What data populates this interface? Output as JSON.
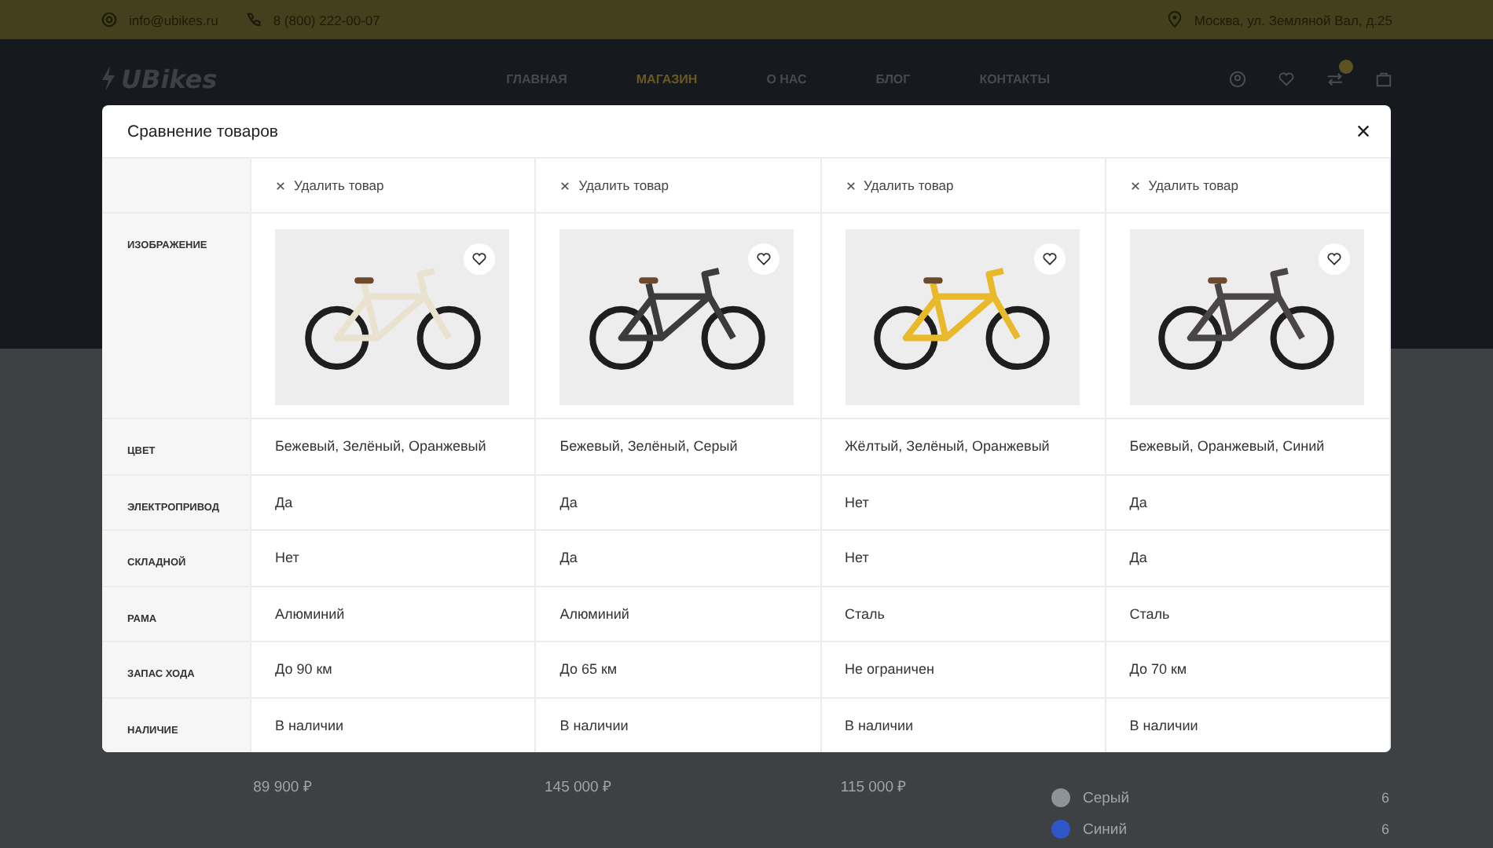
{
  "top_bar": {
    "email": "info@ubikes.ru",
    "phone": "8 (800) 222-00-07",
    "address": "Москва, ул. Земляной Вал, д.25"
  },
  "header": {
    "logo": "UBikes",
    "nav": [
      {
        "label": "ГЛАВНАЯ",
        "selected": false
      },
      {
        "label": "МАГАЗИН",
        "selected": true
      },
      {
        "label": "О НАС",
        "selected": false
      },
      {
        "label": "БЛОГ",
        "selected": false
      },
      {
        "label": "КОНТАКТЫ",
        "selected": false
      }
    ]
  },
  "background_products": [
    {
      "price": "89 900 ₽"
    },
    {
      "price": "145 000 ₽"
    },
    {
      "price": "115 000 ₽"
    }
  ],
  "filter_colors": [
    {
      "name": "Серый",
      "color": "#8e9398",
      "count": "6"
    },
    {
      "name": "Синий",
      "color": "#2f55c8",
      "count": "6"
    }
  ],
  "modal": {
    "title": "Сравнение товаров",
    "products": [
      {
        "remove": "Удалить товар"
      },
      {
        "remove": "Удалить товар"
      },
      {
        "remove": "Удалить товар"
      },
      {
        "remove": "Удалить товар"
      }
    ],
    "rows": [
      {
        "kind": "image",
        "label": "ИЗОБРАЖЕНИЕ"
      },
      {
        "kind": "text",
        "label": "ЦВЕТ",
        "values": [
          "Бежевый, Зелёный, Оранжевый",
          "Бежевый, Зелёный, Серый",
          "Жёлтый, Зелёный, Оранжевый",
          "Бежевый, Оранжевый, Синий"
        ]
      },
      {
        "kind": "text",
        "label": "ЭЛЕКТРОПРИВОД",
        "values": [
          "Да",
          "Да",
          "Нет",
          "Да"
        ]
      },
      {
        "kind": "text",
        "label": "СКЛАДНОЙ",
        "values": [
          "Нет",
          "Да",
          "Нет",
          "Да"
        ]
      },
      {
        "kind": "text",
        "label": "РАМА",
        "values": [
          "Алюминий",
          "Алюминий",
          "Сталь",
          "Сталь"
        ]
      },
      {
        "kind": "text",
        "label": "ЗАПАС ХОДА",
        "values": [
          "До 90 км",
          "До 65 км",
          "Не ограничен",
          "До 70 км"
        ]
      },
      {
        "kind": "text",
        "label": "НАЛИЧИЕ",
        "values": [
          "В наличии",
          "В наличии",
          "В наличии",
          "В наличии"
        ]
      }
    ]
  }
}
